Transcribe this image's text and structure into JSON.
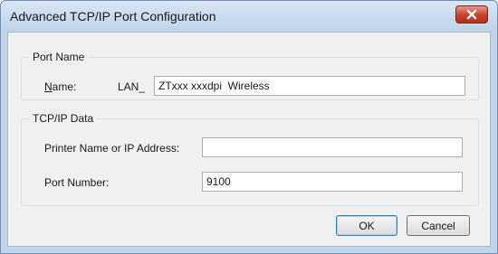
{
  "window": {
    "title": "Advanced TCP/IP Port Configuration"
  },
  "port_name_group": {
    "label": "Port Name",
    "name_label": "Name:",
    "name_prefix": "LAN_",
    "name_value": "ZTxxx xxxdpi  Wireless"
  },
  "tcpip_group": {
    "label": "TCP/IP Data",
    "printer_label": "Printer Name or IP Address:",
    "printer_value": "",
    "port_label": "Port Number:",
    "port_value": "9100"
  },
  "buttons": {
    "ok": "OK",
    "cancel": "Cancel"
  },
  "colors": {
    "close_button": "#c6412c",
    "titlebar": "#c4d3e6",
    "client_background": "#f0f0f0"
  }
}
